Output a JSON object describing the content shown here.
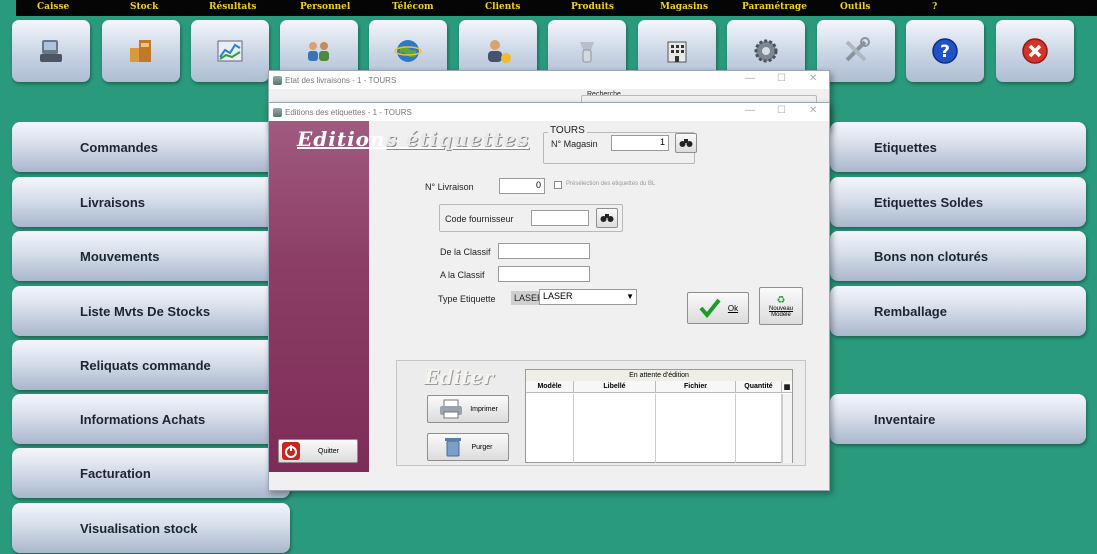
{
  "menu": [
    "Caisse",
    "Stock",
    "Résultats",
    "Personnel",
    "Télécom",
    "Clients",
    "Produits",
    "Magasins",
    "Paramétrage",
    "Outils",
    "?"
  ],
  "toolbar_icons": [
    "register-icon",
    "stock-boxes-icon",
    "results-chart-icon",
    "personnel-icon",
    "telecom-globe-icon",
    "clients-icon",
    "products-icon",
    "stores-icon",
    "settings-gear-icon",
    "tools-icon",
    "help-icon",
    "close-icon"
  ],
  "left_buttons": [
    "Commandes",
    "Livraisons",
    "Mouvements",
    "Liste Mvts De Stocks",
    "Reliquats commande",
    "Informations Achats",
    "Facturation",
    "Visualisation stock"
  ],
  "right_buttons": [
    "Etiquettes",
    "Etiquettes Soldes",
    "Bons non cloturés",
    "Remballage",
    "Inventaire"
  ],
  "back_window": {
    "title": "Etat des livraisons - 1 - TOURS",
    "search_label": "Recherche"
  },
  "dialog": {
    "title": "Editions des etiquettes - 1 - TOURS",
    "heading_left": "Edition",
    "heading_right": "s étiquettes",
    "store_group": "TOURS",
    "store_no_label": "N° Magasin",
    "store_no_value": "1",
    "delivery_label": "N° Livraison",
    "delivery_value": "0",
    "preselect_label": "Présélection des etiquettes du BL",
    "supplier_label": "Code fournisseur",
    "from_classif_label": "De la Classif",
    "to_classif_label": "A la Classif",
    "type_label": "Type Etiquette",
    "type_code": "LASER",
    "type_value": "LASER",
    "ok_label": "Ok",
    "new_model_label_1": "Nouveau",
    "new_model_label_2": "Modèle",
    "editer_title": "Editer",
    "print_label": "Imprimer",
    "purge_label": "Purger",
    "quit_label": "Quitter",
    "table": {
      "caption": "En attente d'édition",
      "columns": [
        "Modèle",
        "Libellé",
        "Fichier",
        "Quantité"
      ]
    }
  }
}
